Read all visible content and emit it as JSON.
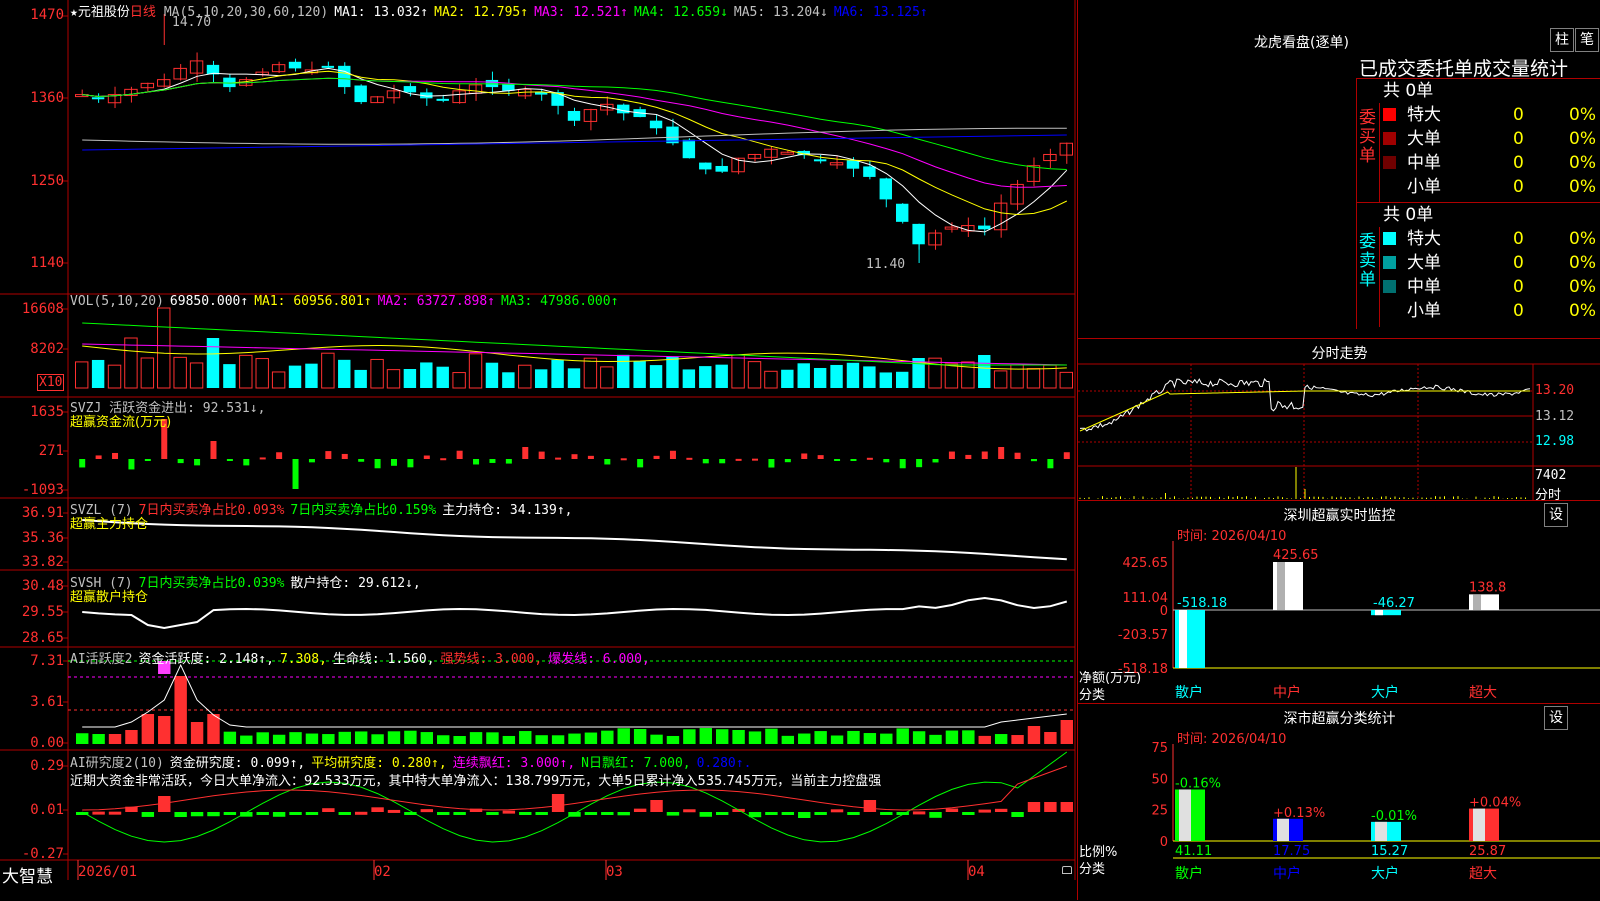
{
  "stock": {
    "name": "★元祖股份",
    "period": "日线",
    "high_label": "14.70",
    "low_label": "11.40"
  },
  "main_axis": {
    "ticks": [
      "1470",
      "1360",
      "1250",
      "1140"
    ]
  },
  "ma_legend": [
    {
      "text": "MA(5,10,20,30,60,120)",
      "color": "#c0c0c0"
    },
    {
      "text": "MA1: 13.032↑",
      "color": "#ffffff"
    },
    {
      "text": "MA2: 12.795↑",
      "color": "#ffff00"
    },
    {
      "text": "MA3: 12.521↑",
      "color": "#ff00ff"
    },
    {
      "text": "MA4: 12.659↓",
      "color": "#00ff00"
    },
    {
      "text": "MA5: 13.204↓",
      "color": "#c0c0c0"
    },
    {
      "text": "MA6: 13.125↑",
      "color": "#0000ff"
    }
  ],
  "vol": {
    "ticks": [
      "16608",
      "8202"
    ],
    "unit": "X10",
    "legend": [
      {
        "text": "VOL(5,10,20)",
        "color": "#c0c0c0"
      },
      {
        "text": "69850.000↑",
        "color": "#ffffff"
      },
      {
        "text": "MA1: 60956.801↑",
        "color": "#ffff00"
      },
      {
        "text": "MA2: 63727.898↑",
        "color": "#ff00ff"
      },
      {
        "text": "MA3: 47986.000↑",
        "color": "#00ff00"
      }
    ]
  },
  "svzj": {
    "ticks": [
      "1635",
      "271",
      "-1093"
    ],
    "legend": [
      {
        "text": "SVZJ  活跃资金进出: 92.531↓,",
        "color": "#c0c0c0"
      }
    ],
    "sub": "超赢资金流(万元)"
  },
  "svzl": {
    "ticks": [
      "36.91",
      "35.36",
      "33.82"
    ],
    "legend": [
      {
        "text": "SVZL (7)",
        "color": "#c0c0c0"
      },
      {
        "text": "7日内买卖净占比0.093%",
        "color": "#ff3030"
      },
      {
        "text": "7日内买卖净占比0.159%",
        "color": "#00ff00"
      },
      {
        "text": "主力持仓: 34.139↑,",
        "color": "#ffffff"
      }
    ],
    "sub": "超赢主力持仓"
  },
  "svsh": {
    "ticks": [
      "30.48",
      "29.55",
      "28.65"
    ],
    "legend": [
      {
        "text": "SVSH (7)",
        "color": "#c0c0c0"
      },
      {
        "text": "7日内买卖净占比0.039%",
        "color": "#00ff00"
      },
      {
        "text": "散户持仓: 29.612↓,",
        "color": "#ffffff"
      }
    ],
    "sub": "超赢散户持仓"
  },
  "ai1": {
    "ticks": [
      "7.31",
      "3.61",
      "0.00"
    ],
    "legend": [
      {
        "text": "AI活跃度2",
        "color": "#c0c0c0"
      },
      {
        "text": "资金活跃度: 2.148↑,",
        "color": "#ffffff"
      },
      {
        "text": "7.308,",
        "color": "#ffff00"
      },
      {
        "text": "生命线: 1.560,",
        "color": "#ffffff"
      },
      {
        "text": "强势线: 3.000,",
        "color": "#ff3030"
      },
      {
        "text": "爆发线: 6.000,",
        "color": "#ff00ff"
      }
    ]
  },
  "ai2": {
    "ticks": [
      "0.29",
      "0.01",
      "-0.27"
    ],
    "legend": [
      {
        "text": "AI研究度2(10)",
        "color": "#c0c0c0"
      },
      {
        "text": "资金研究度: 0.099↑,",
        "color": "#ffffff"
      },
      {
        "text": "平均研究度: 0.280↑,",
        "color": "#ffff00"
      },
      {
        "text": "连续飘红: 3.000↑,",
        "color": "#ff00ff"
      },
      {
        "text": "N日飘红: 7.000,",
        "color": "#00ff00"
      },
      {
        "text": "0.280↑.",
        "color": "#0000ff"
      }
    ],
    "comment": "近期大资金非常活跃，今日大单净流入：92.533万元，其中特大单净流入：138.799万元，大单5日累计净入535.745万元，当前主力控盘强"
  },
  "date_axis": {
    "labels": [
      "2026/01",
      "02",
      "03",
      "04"
    ]
  },
  "app_logo": "大智慧",
  "dragon": {
    "title": "龙虎看盘(逐单)",
    "btn_zhu": "柱",
    "btn_bi": "笔",
    "header": "已成交委托单成交量统计",
    "buy": {
      "label": "委买单",
      "total": "共 0单",
      "rows": [
        {
          "name": "特大",
          "color": "#ff0000",
          "count": "0",
          "pct": "0%"
        },
        {
          "name": "大单",
          "color": "#a00000",
          "count": "0",
          "pct": "0%"
        },
        {
          "name": "中单",
          "color": "#700000",
          "count": "0",
          "pct": "0%"
        },
        {
          "name": "小单",
          "color": "#000000",
          "count": "0",
          "pct": "0%"
        }
      ]
    },
    "sell": {
      "label": "委卖单",
      "total": "共 0单",
      "rows": [
        {
          "name": "特大",
          "color": "#00ffff",
          "count": "0",
          "pct": "0%"
        },
        {
          "name": "大单",
          "color": "#00a0a0",
          "count": "0",
          "pct": "0%"
        },
        {
          "name": "中单",
          "color": "#007070",
          "count": "0",
          "pct": "0%"
        },
        {
          "name": "小单",
          "color": "#000000",
          "count": "0",
          "pct": "0%"
        }
      ]
    }
  },
  "intraday": {
    "title": "分时走势",
    "ticks": [
      "13.20",
      "13.12",
      "12.98"
    ],
    "vol_label": "7402",
    "vol_unit": "分时"
  },
  "monitor": {
    "title": "深圳超赢实时监控",
    "settings": "设",
    "time": "时间: 2026/04/10",
    "ticks": [
      "425.65",
      "111.04",
      "0",
      "-203.57",
      "-518.18"
    ],
    "ylabel": "净额(万元)",
    "xlabel": "分类",
    "categories": [
      "散户",
      "中户",
      "大户",
      "超大"
    ],
    "values": [
      -518.18,
      425.65,
      -46.27,
      138.8
    ],
    "value_labels": [
      "-518.18",
      "425.65",
      "-46.27",
      "138.8"
    ]
  },
  "classify": {
    "title": "深市超赢分类统计",
    "settings": "设",
    "time": "时间: 2026/04/10",
    "ticks": [
      "75",
      "50",
      "25",
      "0"
    ],
    "ylabel": "比例%",
    "xlabel": "分类",
    "categories": [
      "散户",
      "中户",
      "大户",
      "超大"
    ],
    "values": [
      41.11,
      17.75,
      15.27,
      25.87
    ],
    "changes": [
      "-0.16%",
      "+0.13%",
      "-0.01%",
      "+0.04%"
    ]
  },
  "colors": {
    "up": "#ff3030",
    "down": "#00ffff",
    "grid": "#b00000",
    "green": "#00ff00"
  }
}
